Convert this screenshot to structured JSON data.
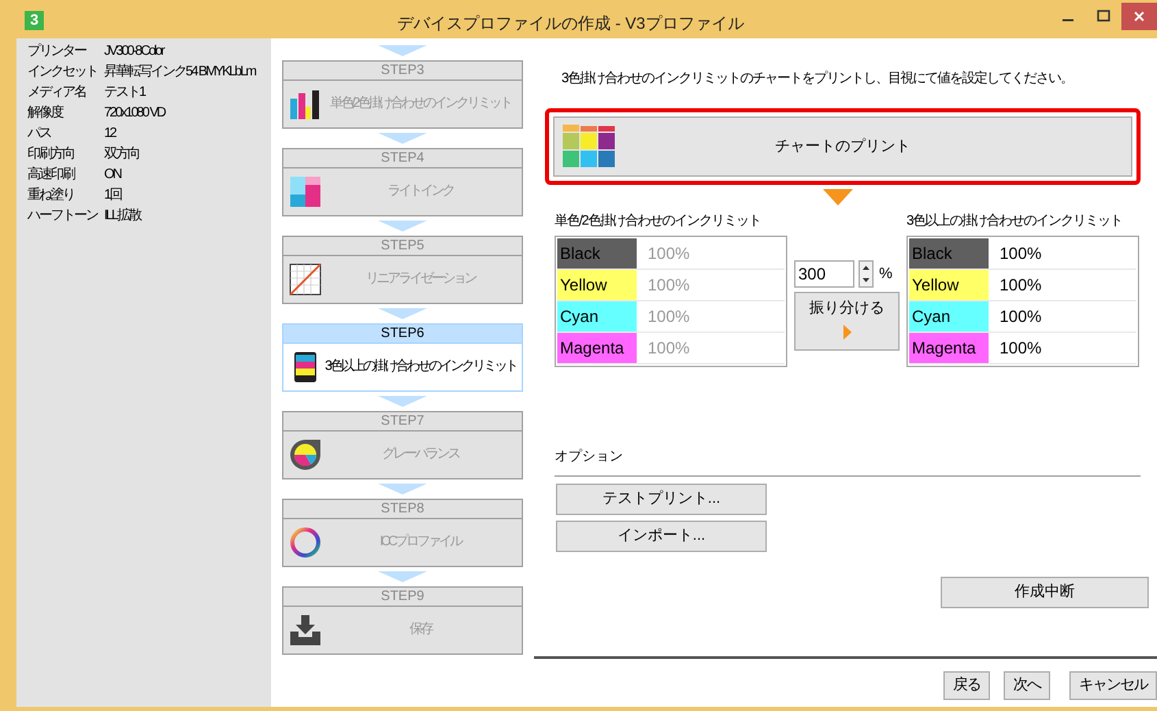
{
  "window": {
    "title": "デバイスプロファイルの作成 - V3プロファイル",
    "app_icon": "3"
  },
  "info": [
    {
      "label": "プリンター",
      "value": "JV300-8Color"
    },
    {
      "label": "インクセット",
      "value": "昇華転写インク54 BMYKLbLm"
    },
    {
      "label": "メディア名",
      "value": "テスト1"
    },
    {
      "label": "解像度",
      "value": "720x1080 VD"
    },
    {
      "label": "パス",
      "value": "12"
    },
    {
      "label": "印刷方向",
      "value": "双方向"
    },
    {
      "label": "高速印刷",
      "value": "ON"
    },
    {
      "label": "重ね塗り",
      "value": "1回"
    },
    {
      "label": "ハーフトーン",
      "value": "ILL拡散"
    }
  ],
  "steps": [
    {
      "step": "STEP3",
      "label": "単色/2色掛け合わせのインクリミット",
      "selected": false
    },
    {
      "step": "STEP4",
      "label": "ライトインク",
      "selected": false
    },
    {
      "step": "STEP5",
      "label": "リニアライゼーション",
      "selected": false
    },
    {
      "step": "STEP6",
      "label": "3色以上の掛け合わせのインクリミット",
      "selected": true
    },
    {
      "step": "STEP7",
      "label": "グレーバランス",
      "selected": false
    },
    {
      "step": "STEP8",
      "label": "ICCプロファイル",
      "selected": false
    },
    {
      "step": "STEP9",
      "label": "保存",
      "selected": false
    }
  ],
  "instruction": "3色掛け合わせのインクリミットのチャートをプリントし、目視にて値を設定してください。",
  "print_chart_button": {
    "label": "チャートのプリント"
  },
  "tables": [
    {
      "heading": "単色/2色掛け合わせのインクリミット",
      "disabled": true,
      "rows": [
        {
          "name": "Black",
          "color": "#5f5f5f",
          "value": "100%"
        },
        {
          "name": "Yellow",
          "color": "#ffff66",
          "value": "100%"
        },
        {
          "name": "Cyan",
          "color": "#66ffff",
          "value": "100%"
        },
        {
          "name": "Magenta",
          "color": "#ff66ff",
          "value": "100%"
        }
      ]
    },
    {
      "heading": "3色以上の掛け合わせのインクリミット",
      "disabled": false,
      "rows": [
        {
          "name": "Black",
          "color": "#5f5f5f",
          "value": "100%"
        },
        {
          "name": "Yellow",
          "color": "#ffff66",
          "value": "100%"
        },
        {
          "name": "Cyan",
          "color": "#66ffff",
          "value": "100%"
        },
        {
          "name": "Magenta",
          "color": "#ff66ff",
          "value": "100%"
        }
      ]
    }
  ],
  "total_limit": {
    "value": "300",
    "unit": "%"
  },
  "distribute_button": {
    "label": "振り分ける"
  },
  "options": {
    "label": "オプション",
    "buttons": [
      "テストプリント...",
      "インポート..."
    ]
  },
  "abort_button": "作成中断",
  "nav_buttons": [
    "戻る",
    "次へ",
    "キャンセル"
  ]
}
